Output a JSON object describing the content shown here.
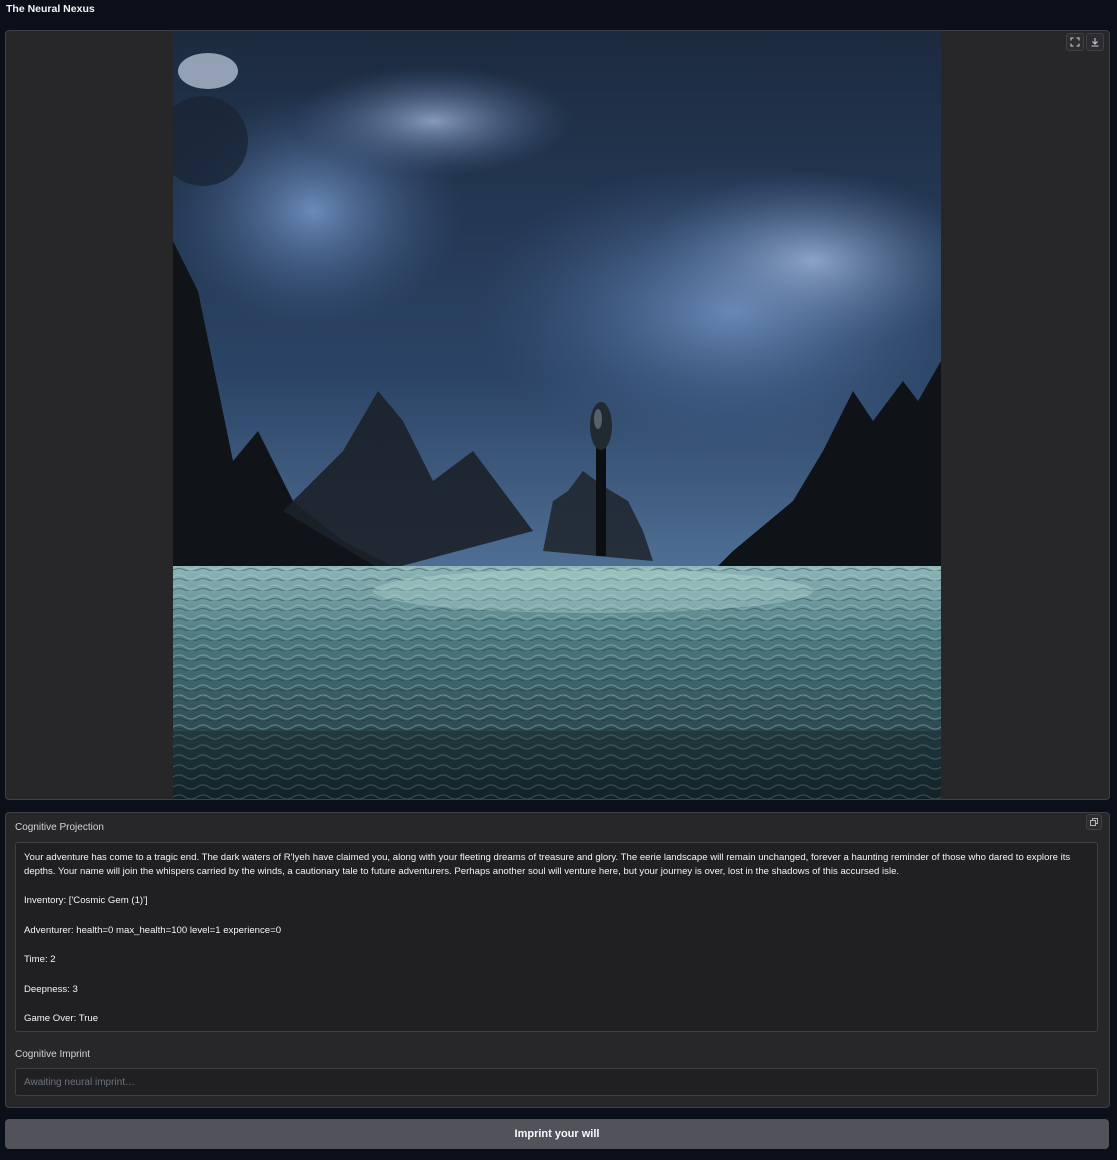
{
  "app": {
    "title": "The Neural Nexus"
  },
  "image_panel": {
    "fullscreen_icon": "fullscreen-icon",
    "download_icon": "download-icon"
  },
  "output": {
    "label": "Cognitive Projection",
    "copy_icon": "copy-icon",
    "paragraphs": [
      "Your adventure has come to a tragic end. The dark waters of R'lyeh have claimed you, along with your fleeting dreams of treasure and glory. The eerie landscape will remain unchanged, forever a haunting reminder of those who dared to explore its depths. Your name will join the whispers carried by the winds, a cautionary tale to future adventurers. Perhaps another soul will venture here, but your journey is over, lost in the shadows of this accursed isle.",
      "Inventory: ['Cosmic Gem (1)']",
      "Adventurer: health=0 max_health=100 level=1 experience=0",
      "Time: 2",
      "Deepness: 3",
      "Game Over: True"
    ]
  },
  "input": {
    "label": "Cognitive Imprint",
    "placeholder": "Awaiting neural imprint…",
    "value": ""
  },
  "submit": {
    "label": "Imprint your will"
  }
}
